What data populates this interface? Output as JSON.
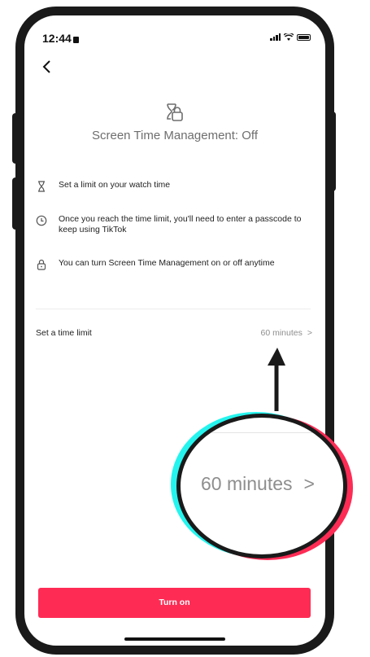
{
  "status_bar": {
    "time": "12:44"
  },
  "header": {
    "back_icon": "chevron-left-icon",
    "icon": "hourglass-lock-icon",
    "title": "Screen Time Management: Off"
  },
  "features": [
    {
      "icon": "hourglass-icon",
      "text": "Set a limit on your watch time"
    },
    {
      "icon": "clock-icon",
      "text": "Once you reach the time limit, you'll need to enter a passcode to keep using TikTok"
    },
    {
      "icon": "lock-icon",
      "text": "You can turn Screen Time Management on or off anytime"
    }
  ],
  "time_limit": {
    "label": "Set a time limit",
    "value": "60 minutes",
    "chevron": ">"
  },
  "callout": {
    "value": "60 minutes",
    "chevron": ">"
  },
  "primary_button": {
    "label": "Turn on"
  },
  "colors": {
    "accent": "#fe2c55",
    "cyan": "#25f4ee",
    "frame": "#1a1a1a",
    "muted_text": "#8e8e8e"
  }
}
